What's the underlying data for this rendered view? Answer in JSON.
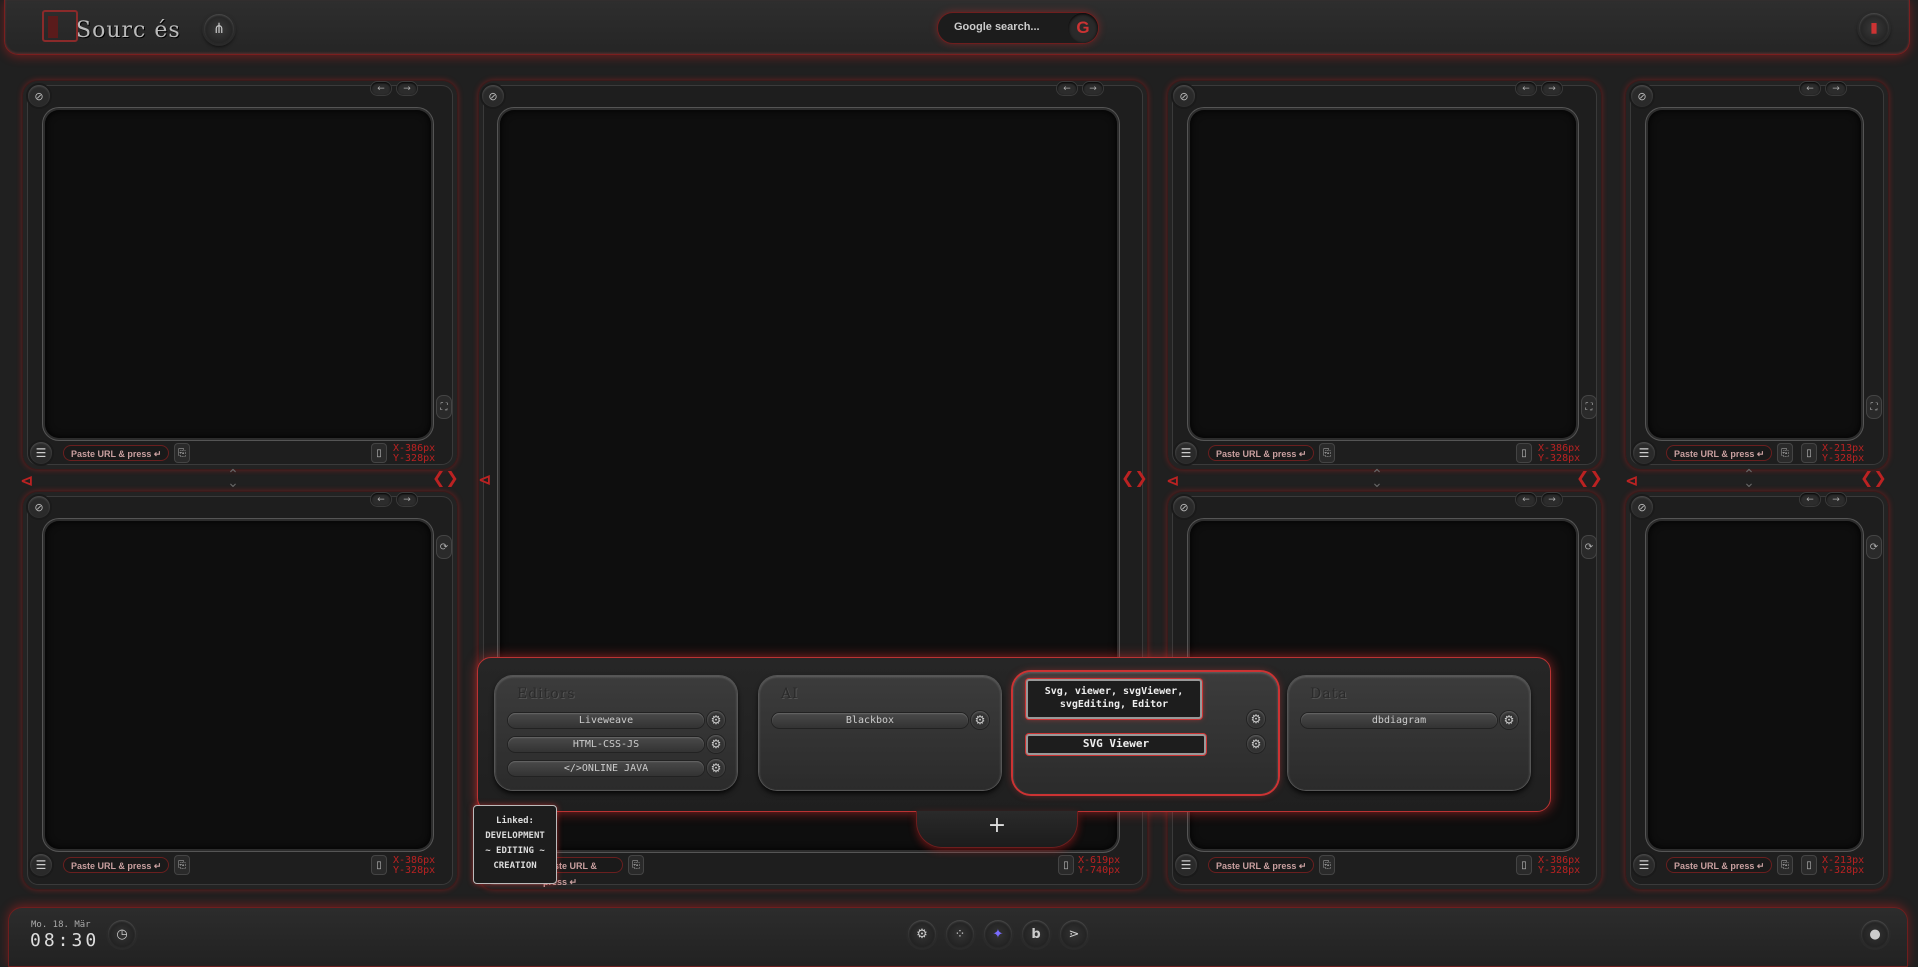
{
  "app": {
    "brand": "Sourc és",
    "search_placeholder": "Google search...",
    "google_label": "G"
  },
  "panels": {
    "url_placeholder": "Paste URL & press ↵",
    "coords": {
      "p1": [
        "X-386px",
        "Y-328px"
      ],
      "p3": [
        "X-386px",
        "Y-328px"
      ],
      "p4": [
        "X-213px",
        "Y-328px"
      ],
      "p5": [
        "X-386px",
        "Y-328px"
      ],
      "p2": [
        "X-619px",
        "Y-740px"
      ],
      "p6": [
        "X-386px",
        "Y-328px"
      ],
      "p7": [
        "X-213px",
        "Y-328px"
      ]
    }
  },
  "overlay": {
    "groups": [
      {
        "title": "Editors",
        "items": [
          "Liveweave",
          "HTML-CSS-JS",
          "</>ONLINE JAVA"
        ]
      },
      {
        "title": "AI",
        "items": [
          "Blackbox"
        ]
      },
      {
        "title": "",
        "items": [
          "SVG Viewer"
        ]
      },
      {
        "title": "Data",
        "items": [
          "dbdiagram"
        ]
      }
    ],
    "tooltip_line1": "Svg, viewer, svgViewer,",
    "tooltip_line2": "svgEditing, Editor",
    "linked_lines": [
      "Linked:",
      "DEVELOPMENT",
      "~ EDITING ~",
      "CREATION"
    ],
    "plus_label": "+"
  },
  "footer": {
    "date": "Mo. 18. Mär",
    "time": "08:30"
  },
  "colors": {
    "accent": "#cc2a2a",
    "background": "#202020",
    "screen": "#0e0e0e"
  }
}
